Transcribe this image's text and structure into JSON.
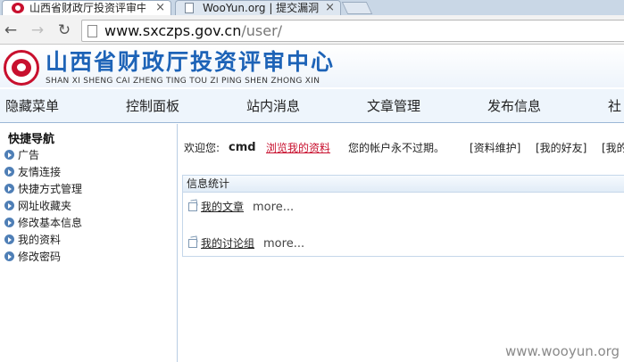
{
  "browser": {
    "tabs": [
      {
        "title": "山西省财政厅投资评审中心",
        "close": "×"
      },
      {
        "title": "WooYun.org | 提交漏洞",
        "close": "×"
      }
    ],
    "url_host": "www.sxczps.gov.cn",
    "url_path": "/user/",
    "back_glyph": "←",
    "forward_glyph": "→",
    "reload_glyph": "↻"
  },
  "site": {
    "title": "山西省财政厅投资评审中心",
    "pinyin": "SHAN XI SHENG CAI ZHENG TING TOU ZI PING SHEN ZHONG XIN",
    "brand_color": "#1d63b7",
    "logo_color": "#c8102e"
  },
  "nav": {
    "items": [
      "隐藏菜单",
      "控制面板",
      "站内消息",
      "文章管理",
      "发布信息",
      "社"
    ]
  },
  "sidebar": {
    "title": "快捷导航",
    "items": [
      "广告",
      "友情连接",
      "快捷方式管理",
      "网址收藏夹",
      "修改基本信息",
      "我的资料",
      "修改密码"
    ]
  },
  "welcome": {
    "greeting": "欢迎您:",
    "username": "cmd",
    "view_profile": "浏览我的资料",
    "account_status": "您的帐户永不过期。",
    "link_profile_maintain": "[资料维护]",
    "link_friends": "[我的好友]",
    "link_more": "[我的"
  },
  "stats": {
    "title": "信息统计",
    "rows": [
      {
        "label": "我的文章",
        "more": "more..."
      },
      {
        "label": "我的讨论组",
        "more": "more..."
      }
    ]
  },
  "watermark": "www.wooyun.org"
}
